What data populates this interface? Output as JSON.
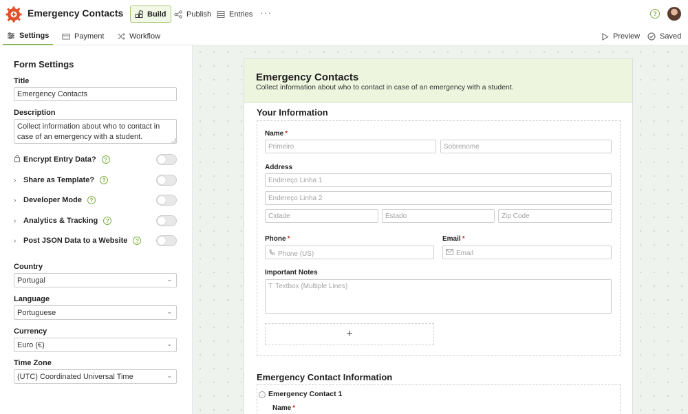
{
  "app": {
    "title": "Emergency Contacts"
  },
  "top_nav": {
    "build": "Build",
    "publish": "Publish",
    "entries": "Entries",
    "more": "···"
  },
  "sub_nav": {
    "settings": "Settings",
    "payment": "Payment",
    "workflow": "Workflow",
    "preview": "Preview",
    "saved": "Saved"
  },
  "panel": {
    "heading": "Form Settings",
    "title_label": "Title",
    "title_value": "Emergency Contacts",
    "description_label": "Description",
    "description_value": "Collect information about who to contact in case of an emergency with a student.",
    "toggles": [
      {
        "label": "Encrypt Entry Data?",
        "on": false
      },
      {
        "label": "Share as Template?",
        "on": false
      },
      {
        "label": "Developer Mode",
        "on": false
      },
      {
        "label": "Analytics & Tracking",
        "on": false
      },
      {
        "label": "Post JSON Data to a Website",
        "on": false
      }
    ],
    "country_label": "Country",
    "country_value": "Portugal",
    "language_label": "Language",
    "language_value": "Portuguese",
    "currency_label": "Currency",
    "currency_value": "Euro (€)",
    "timezone_label": "Time Zone",
    "timezone_value": "(UTC) Coordinated Universal Time"
  },
  "form": {
    "title": "Emergency Contacts",
    "description": "Collect information about who to contact in case of an emergency with a student.",
    "section1": "Your Information",
    "name_label": "Name",
    "first_ph": "Primeiro",
    "last_ph": "Sobrenome",
    "address_label": "Address",
    "addr1_ph": "Endereço Linha 1",
    "addr2_ph": "Endereço Linha 2",
    "city_ph": "Cidade",
    "state_ph": "Estado",
    "zip_ph": "Zip Code",
    "phone_label": "Phone",
    "phone_ph": "Phone (US)",
    "email_label": "Email",
    "email_ph": "Email",
    "notes_label": "Important Notes",
    "notes_ph": "Textbox (Multiple Lines)",
    "add_symbol": "+",
    "section2": "Emergency Contact Information",
    "contact1": "Emergency Contact 1",
    "contact1_name_label": "Name"
  },
  "colors": {
    "accent": "#7cae3f",
    "brand": "#e0502a",
    "header_bg": "#eef5df",
    "canvas_bg": "#eef3ee",
    "required": "#c0392b"
  }
}
